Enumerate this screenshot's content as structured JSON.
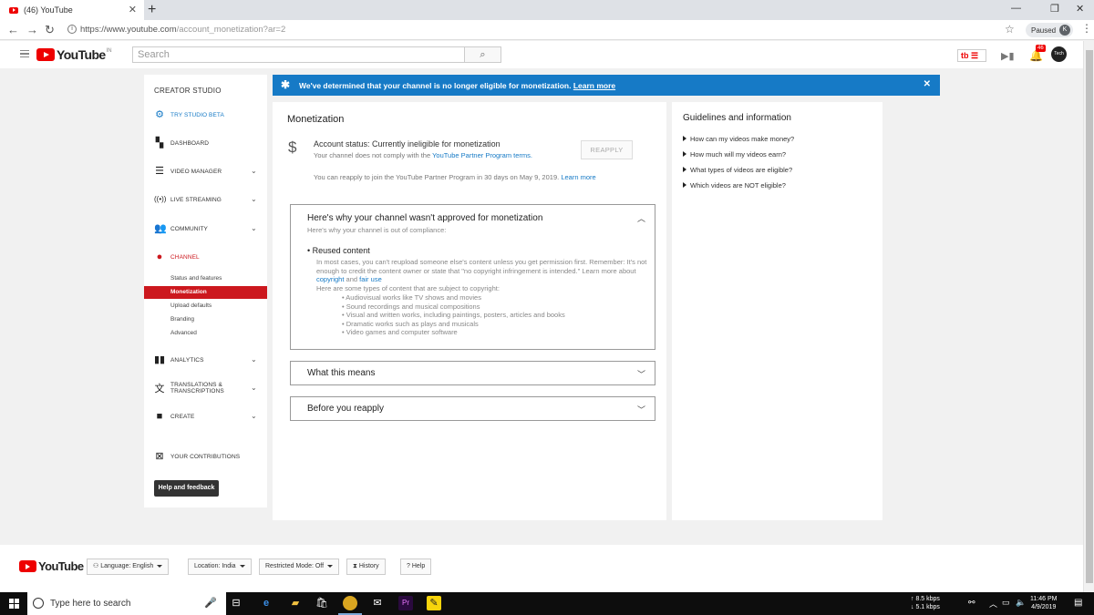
{
  "browser": {
    "tab_title": "(46) YouTube",
    "url_main": "https://www.youtube.com",
    "url_path": "/account_monetization?ar=2",
    "profile_status": "Paused",
    "profile_initial": "K"
  },
  "header": {
    "logo_text": "YouTube",
    "region": "IN",
    "search_placeholder": "Search",
    "notification_count": "46",
    "avatar_text": "Tech"
  },
  "sidebar": {
    "title": "CREATOR STUDIO",
    "try_beta": "TRY STUDIO BETA",
    "dashboard": "DASHBOARD",
    "video_manager": "VIDEO MANAGER",
    "live_streaming": "LIVE STREAMING",
    "community": "COMMUNITY",
    "channel": "CHANNEL",
    "channel_sub": [
      "Status and features",
      "Monetization",
      "Upload defaults",
      "Branding",
      "Advanced"
    ],
    "analytics": "ANALYTICS",
    "translations_1": "TRANSLATIONS &",
    "translations_2": "TRANSCRIPTIONS",
    "create": "CREATE",
    "contributions": "YOUR CONTRIBUTIONS",
    "help_feedback": "Help and feedback"
  },
  "banner": {
    "text": "We've determined that your channel is no longer eligible for monetization.",
    "link": "Learn more"
  },
  "main": {
    "title": "Monetization",
    "account_status": "Account status: Currently ineligible for monetization",
    "noncompliance": "Your channel does not comply with the",
    "terms_link": "YouTube Partner Program terms.",
    "reapply_btn": "REAPPLY",
    "reapply_note": "You can reapply to join the YouTube Partner Program in 30 days on May 9, 2019.",
    "learn_more": "Learn more",
    "section1": {
      "title": "Here's why your channel wasn't approved for monetization",
      "subtitle": "Here's why your channel is out of compliance:",
      "bullet": "Reused content",
      "para": "In most cases, you can't reupload someone else's content unless you get permission first. Remember: It's not enough to credit the content owner or state that \"no copyright infringement is intended.\" Learn more about",
      "copyright": "copyright",
      "and": "and",
      "fair_use": "fair use",
      "types_intro": "Here are some types of content that are subject to copyright:",
      "types": [
        "Audiovisual works like TV shows and movies",
        "Sound recordings and musical compositions",
        "Visual and written works, including paintings, posters, articles and books",
        "Dramatic works such as plays and musicals",
        "Video games and computer software"
      ]
    },
    "section2_title": "What this means",
    "section3_title": "Before you reapply"
  },
  "guide": {
    "title": "Guidelines and information",
    "items": [
      "How can my videos make money?",
      "How much will my videos earn?",
      "What types of videos are eligible?",
      "Which videos are NOT eligible?"
    ]
  },
  "footer": {
    "logo_text": "YouTube",
    "language": "Language: English",
    "location": "Location: India",
    "restricted": "Restricted Mode: Off",
    "history": "History",
    "help": "Help"
  },
  "taskbar": {
    "search_placeholder": "Type here to search",
    "net_up": "8.5 kbps",
    "net_down": "5.1 kbps",
    "time": "11:46 PM",
    "date": "4/9/2019"
  }
}
